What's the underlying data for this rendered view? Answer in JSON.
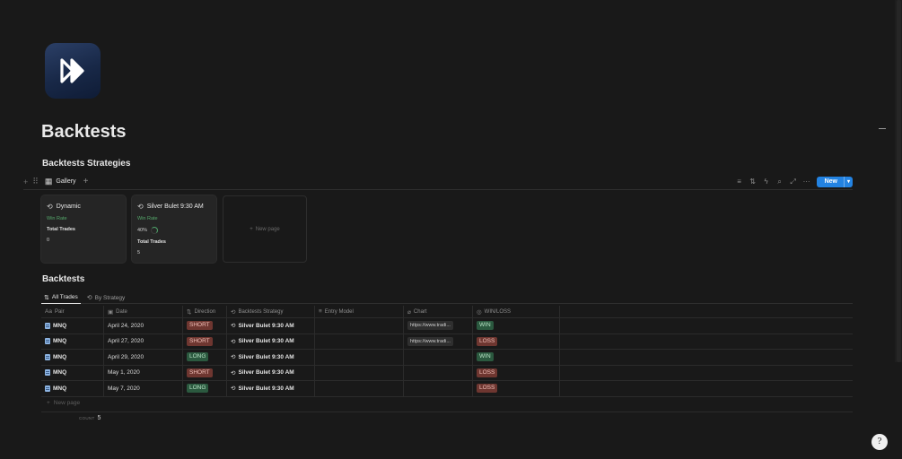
{
  "page": {
    "title": "Backtests",
    "icon": "fast-forward-icon"
  },
  "strategies_section": {
    "heading": "Backtests Strategies",
    "view_tab": "Gallery",
    "toolbar": {
      "new_label": "New",
      "icons": [
        "filter-icon",
        "sort-icon",
        "bolt-icon",
        "search-icon",
        "expand-icon",
        "more-icon"
      ]
    },
    "cards": [
      {
        "title": "Dynamic",
        "win_rate_label": "Win Rate",
        "win_rate_value": "",
        "total_trades_label": "Total Trades",
        "total_trades_value": "0"
      },
      {
        "title": "Silver Bulet 9:30 AM",
        "win_rate_label": "Win Rate",
        "win_rate_value": "40%",
        "win_rate_fraction": 0.4,
        "total_trades_label": "Total Trades",
        "total_trades_value": "5"
      }
    ],
    "new_page_label": "New page"
  },
  "trades_section": {
    "heading": "Backtests",
    "tabs": [
      {
        "label": "All Trades",
        "active": true
      },
      {
        "label": "By Strategy",
        "active": false
      }
    ],
    "columns": {
      "pair": "Pair",
      "date": "Date",
      "direction": "Direction",
      "strategy": "Backtests Strategy",
      "entry_model": "Entry Model",
      "chart": "Chart",
      "winloss": "WIN/LOSS"
    },
    "rows": [
      {
        "pair": "MNQ",
        "date": "April 24, 2020",
        "direction": "SHORT",
        "strategy": "Silver Bulet 9:30 AM",
        "entry_model": "",
        "chart": "https://www.tradi...",
        "result": "WIN"
      },
      {
        "pair": "MNQ",
        "date": "April 27, 2020",
        "direction": "SHORT",
        "strategy": "Silver Bulet 9:30 AM",
        "entry_model": "",
        "chart": "https://www.tradi...",
        "result": "LOSS"
      },
      {
        "pair": "MNQ",
        "date": "April 29, 2020",
        "direction": "LONG",
        "strategy": "Silver Bulet 9:30 AM",
        "entry_model": "",
        "chart": "",
        "result": "WIN"
      },
      {
        "pair": "MNQ",
        "date": "May 1, 2020",
        "direction": "SHORT",
        "strategy": "Silver Bulet 9:30 AM",
        "entry_model": "",
        "chart": "",
        "result": "LOSS"
      },
      {
        "pair": "MNQ",
        "date": "May 7, 2020",
        "direction": "LONG",
        "strategy": "Silver Bulet 9:30 AM",
        "entry_model": "",
        "chart": "",
        "result": "LOSS"
      }
    ],
    "new_page_label": "New page",
    "count_label": "COUNT",
    "count_value": "5"
  },
  "colors": {
    "background": "#191919",
    "accent": "#2383e2",
    "win": "#2b593f",
    "loss": "#6e3630"
  },
  "help_button": "?"
}
